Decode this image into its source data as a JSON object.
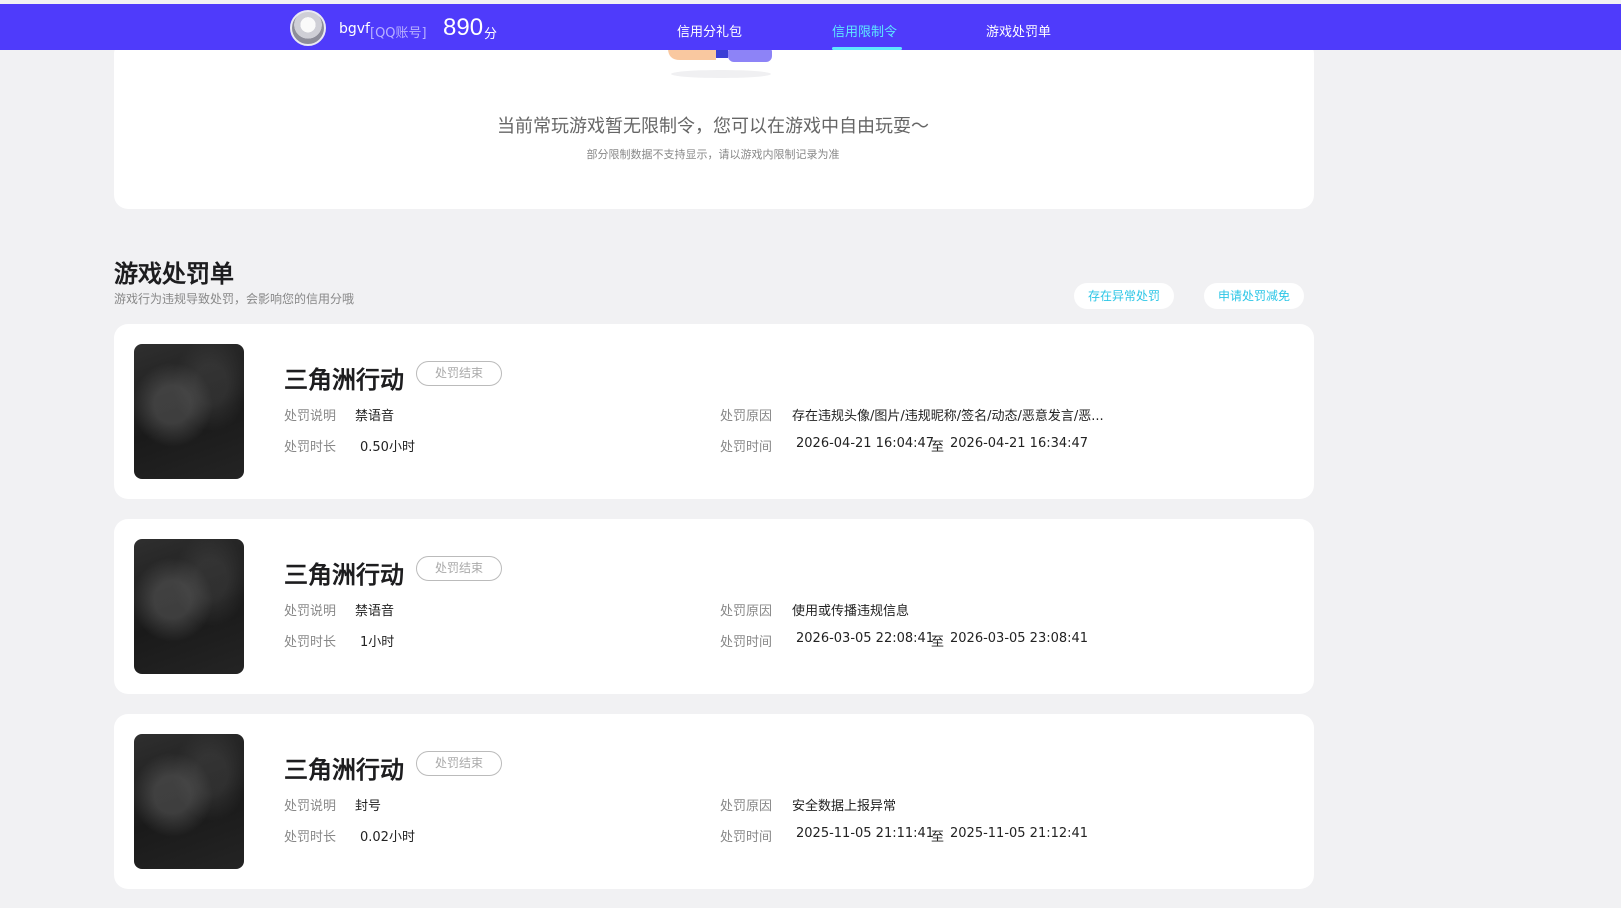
{
  "header": {
    "username": "bgvf",
    "account_type": "[QQ账号]",
    "score": "890",
    "score_unit": "分",
    "tabs": [
      {
        "label": "信用分礼包"
      },
      {
        "label": "信用限制令"
      },
      {
        "label": "游戏处罚单"
      }
    ],
    "accent_color": "#4f3bfb",
    "active_color": "#5ee7ff"
  },
  "restriction": {
    "empty_title": "当前常玩游戏暂无限制令，您可以在游戏中自由玩耍～",
    "empty_note": "部分限制数据不支持显示，请以游戏内限制记录为准"
  },
  "penalty": {
    "title": "游戏处罚单",
    "subtitle": "游戏行为违规导致处罚，会影响您的信用分哦",
    "btn_abnormal": "存在异常处罚",
    "btn_appeal": "申请处罚减免",
    "labels": {
      "desc": "处罚说明",
      "duration": "处罚时长",
      "reason": "处罚原因",
      "time": "处罚时间",
      "to": "至"
    },
    "records": [
      {
        "game": "三角洲行动",
        "status": "处罚结束",
        "desc": "禁语音",
        "duration": "0.50小时",
        "reason": "存在违规头像/图片/违规昵称/签名/动态/恶意发言/恶...",
        "start": "2026-04-21 16:04:47",
        "end": "2026-04-21 16:34:47"
      },
      {
        "game": "三角洲行动",
        "status": "处罚结束",
        "desc": "禁语音",
        "duration": "1小时",
        "reason": "使用或传播违规信息",
        "start": "2026-03-05 22:08:41",
        "end": "2026-03-05 23:08:41"
      },
      {
        "game": "三角洲行动",
        "status": "处罚结束",
        "desc": "封号",
        "duration": "0.02小时",
        "reason": "安全数据上报异常",
        "start": "2025-11-05 21:11:41",
        "end": "2025-11-05 21:12:41"
      }
    ]
  }
}
